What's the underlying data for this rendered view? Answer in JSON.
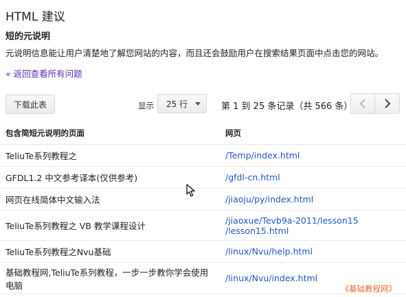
{
  "header": {
    "title": "HTML 建议",
    "subtitle": "短的元说明",
    "description": "元说明信息能让用户清楚地了解您网站的内容，而且还会鼓励用户在搜索结果页面中点击您的网站。",
    "back_link": "« 返回查看所有问题"
  },
  "toolbar": {
    "download_label": "下载此表",
    "show_label": "显示",
    "page_size": "25 行",
    "range_text": "第 1 到 25 条记录（共 566 条）",
    "prev_icon": "chevron-left-icon",
    "next_icon": "chevron-right-icon"
  },
  "table": {
    "columns": [
      "包含简短元说明的页面",
      "网页"
    ],
    "rows": [
      {
        "page": "TeliuTe系列教程之",
        "url": "/Temp/index.html"
      },
      {
        "page": "GFDL1.2 中文参考译本(仅供参考)",
        "url": "/gfdl-cn.html"
      },
      {
        "page": "网页在线简体中文输入法",
        "url": "/jiaoju/py/index.html"
      },
      {
        "page": "TeliuTe系列教程之 VB 教学课程设计",
        "url": "/jiaoxue/Tevb9a-2011/lesson15\n/lesson15.html"
      },
      {
        "page": "TeliuTe系列教程之Nvu基础",
        "url": "/linux/Nvu/help.html"
      },
      {
        "page": "基础教程网,TeliuTe系列教程，一步一步教你学会使用电脑",
        "url": "/linux/Nvu/index.html"
      }
    ]
  },
  "watermark": "《基础教程网》",
  "colors": {
    "link": "#1f57c4",
    "back_link": "#5c2cb4",
    "watermark": "#e26f34"
  }
}
